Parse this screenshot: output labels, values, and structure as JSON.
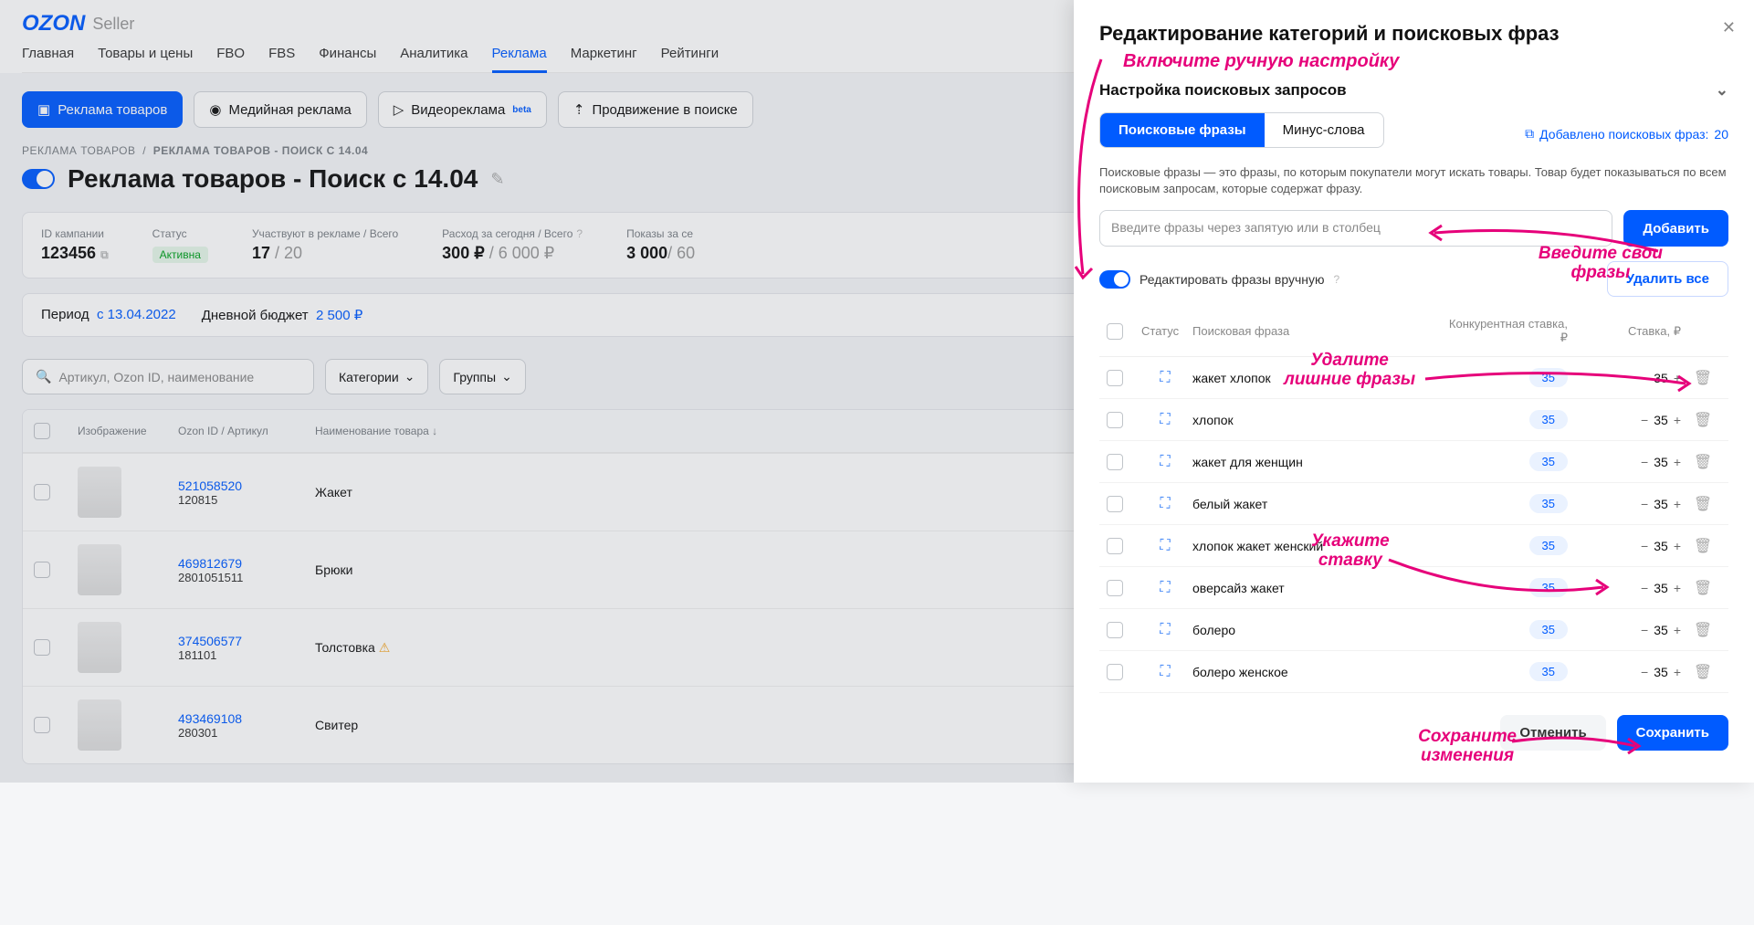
{
  "logo": {
    "brand": "OZON",
    "sub": "Seller"
  },
  "nav": {
    "items": [
      "Главная",
      "Товары и цены",
      "FBO",
      "FBS",
      "Финансы",
      "Аналитика",
      "Реклама",
      "Маркетинг",
      "Рейтинги"
    ],
    "active": "Реклама"
  },
  "pills": {
    "primary": "Реклама товаров",
    "media": "Медийная реклама",
    "video": "Видеореклама",
    "video_beta": "beta",
    "search": "Продвижение в поиске"
  },
  "breadcrumb": {
    "a": "РЕКЛАМА ТОВАРОВ",
    "b": "РЕКЛАМА ТОВАРОВ - ПОИСК С 14.04"
  },
  "title": "Реклама товаров - Поиск с 14.04",
  "stats": {
    "id_label": "ID кампании",
    "id_val": "123456",
    "status_label": "Статус",
    "status_val": "Активна",
    "part_label": "Участвуют в рекламе / Всего",
    "part_a": "17",
    "part_b": "20",
    "spend_label": "Расход за сегодня / Всего",
    "spend_a": "300 ₽",
    "spend_b": "6 000 ₽",
    "views_label": "Показы за се",
    "views_a": "3 000",
    "views_b": "60"
  },
  "period": {
    "label": "Период",
    "value": "с 13.04.2022",
    "budget_label": "Дневной бюджет",
    "budget_value": "2 500 ₽"
  },
  "filter": {
    "search_ph": "Артикул, Ozon ID, наименование",
    "categories": "Категории",
    "groups": "Группы"
  },
  "table": {
    "cols": {
      "img": "Изображение",
      "id": "Ozon ID / Артикул",
      "name": "Наименование товара"
    },
    "rows": [
      {
        "id": "521058520",
        "art": "120815",
        "name": "Жакет",
        "warn": false
      },
      {
        "id": "469812679",
        "art": "2801051511",
        "name": "Брюки",
        "warn": false
      },
      {
        "id": "374506577",
        "art": "181101",
        "name": "Толстовка",
        "warn": true
      },
      {
        "id": "493469108",
        "art": "280301",
        "name": "Свитер",
        "warn": false
      }
    ]
  },
  "panel": {
    "title": "Редактирование категорий и поисковых фраз",
    "sub": "Настройка поисковых запросов",
    "tab_phrases": "Поисковые фразы",
    "tab_minus": "Минус-слова",
    "count_label": "Добавлено поисковых фраз:",
    "count_val": "20",
    "hint": "Поисковые фразы — это фразы, по которым покупатели могут искать товары. Товар будет показываться по всем поисковым запросам, которые содержат фразу.",
    "input_ph": "Введите фразы через запятую или в столбец",
    "add": "Добавить",
    "edit_manual": "Редактировать фразы вручную",
    "delete_all": "Удалить все",
    "cols": {
      "status": "Статус",
      "phrase": "Поисковая фраза",
      "comp": "Конкурентная ставка, ₽",
      "bid": "Ставка, ₽"
    },
    "rows": [
      {
        "phrase": "жакет хлопок",
        "comp": "35",
        "bid": "35"
      },
      {
        "phrase": "хлопок",
        "comp": "35",
        "bid": "35"
      },
      {
        "phrase": "жакет для женщин",
        "comp": "35",
        "bid": "35"
      },
      {
        "phrase": "белый жакет",
        "comp": "35",
        "bid": "35"
      },
      {
        "phrase": "хлопок жакет женский",
        "comp": "35",
        "bid": "35"
      },
      {
        "phrase": "оверсайз жакет",
        "comp": "35",
        "bid": "35"
      },
      {
        "phrase": "болеро",
        "comp": "35",
        "bid": "35"
      },
      {
        "phrase": "болеро женское",
        "comp": "35",
        "bid": "35"
      }
    ],
    "cancel": "Отменить",
    "save": "Сохранить"
  },
  "annot": {
    "a1": "Включите ручную настройку",
    "a2_l1": "Введите свои",
    "a2_l2": "фразы",
    "a3_l1": "Удалите",
    "a3_l2": "лишние фразы",
    "a4_l1": "Укажите",
    "a4_l2": "ставку",
    "a5_l1": "Сохраните",
    "a5_l2": "изменения"
  }
}
